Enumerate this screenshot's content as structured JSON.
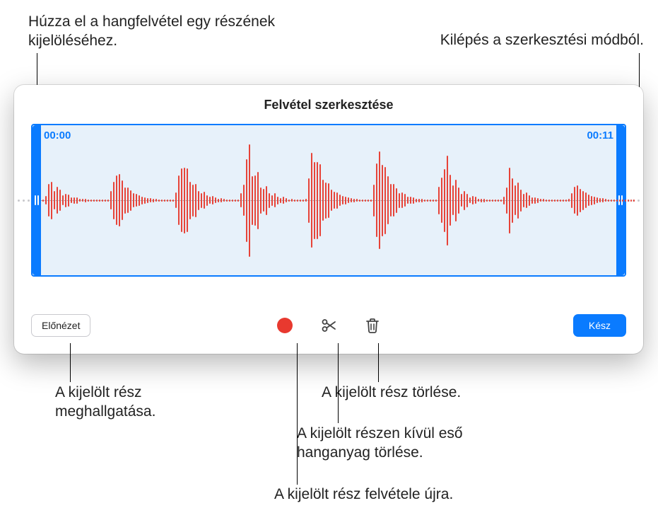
{
  "callouts": {
    "drag_select": "Húzza el a hangfelvétel egy részének kijelöléséhez.",
    "exit_edit": "Kilépés a szerkesztési módból.",
    "preview_listen": "A kijelölt rész meghallgatása.",
    "delete_selection": "A kijelölt rész törlése.",
    "trim_outside": "A kijelölt részen kívül eső hanganyag törlése.",
    "rerecord": "A kijelölt rész felvétele újra."
  },
  "window": {
    "title": "Felvétel szerkesztése",
    "time_start": "00:00",
    "time_end": "00:11",
    "preview_label": "Előnézet",
    "done_label": "Kész"
  },
  "icons": {
    "record": "record-icon",
    "scissors": "scissors-icon",
    "trash": "trash-icon"
  },
  "colors": {
    "accent": "#0a7bff",
    "wave": "#e74338",
    "selection_bg": "#e7f1fa"
  }
}
